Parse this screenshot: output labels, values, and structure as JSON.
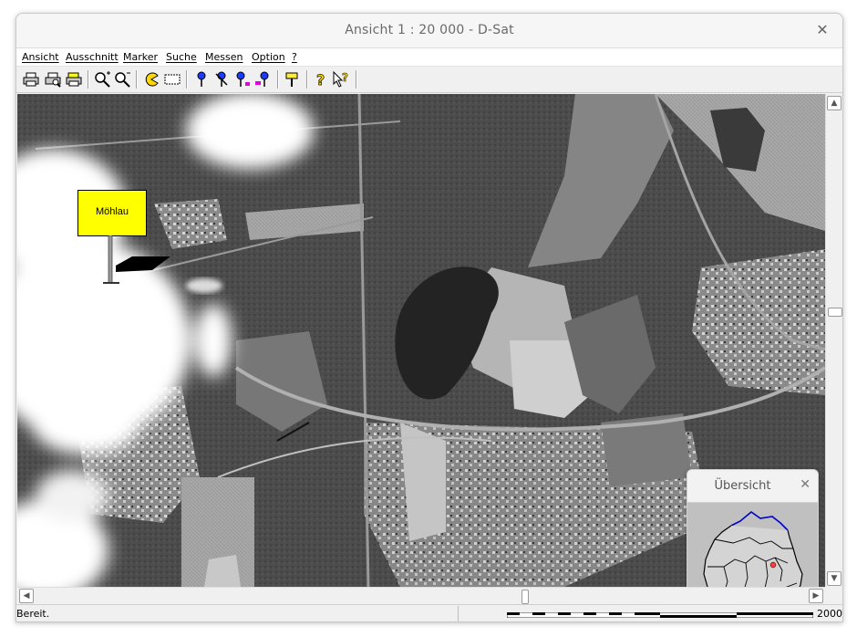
{
  "window": {
    "title": "Ansicht 1 : 20 000   -   D-Sat"
  },
  "menu": [
    {
      "label": "Ansicht"
    },
    {
      "label": "Ausschnitt"
    },
    {
      "label": "Marker"
    },
    {
      "label": "Suche"
    },
    {
      "label": "Messen"
    },
    {
      "label": "Option"
    },
    {
      "label": "?"
    }
  ],
  "toolbar": {
    "icons": [
      "print-icon",
      "print-preview-icon",
      "print-settings-icon",
      "zoom-in-icon",
      "zoom-out-icon",
      "pacman-navigate-icon",
      "select-region-icon",
      "marker-blue-icon",
      "marker-delete-icon",
      "marker-move-icon",
      "marker-edit-icon",
      "signpost-icon",
      "help-icon",
      "context-help-icon"
    ]
  },
  "map": {
    "marker_label": "Möhlau",
    "marker_color": "#ffff00"
  },
  "overview": {
    "title": "Übersicht",
    "highlight_color": "#ff3b3b",
    "coast_color": "#0000cc"
  },
  "status": {
    "text": "Bereit.",
    "scale_value": "2000"
  }
}
